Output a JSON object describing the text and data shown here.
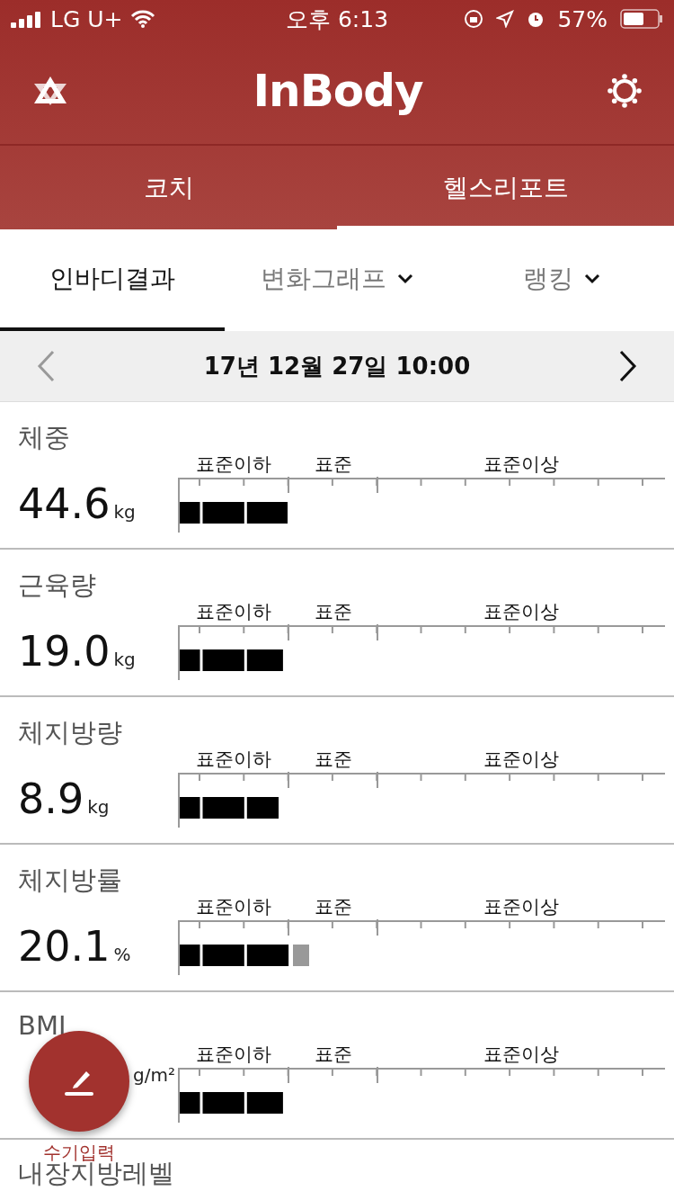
{
  "status_bar": {
    "carrier": "LG U+",
    "time": "오후 6:13",
    "battery": "57%"
  },
  "header": {
    "title": "InBody"
  },
  "main_tabs": [
    {
      "label": "코치",
      "selected": false
    },
    {
      "label": "헬스리포트",
      "selected": true
    }
  ],
  "sub_tabs": [
    {
      "label": "인바디결과",
      "selected": true,
      "dropdown": false
    },
    {
      "label": "변화그래프",
      "selected": false,
      "dropdown": true
    },
    {
      "label": "랭킹",
      "selected": false,
      "dropdown": true
    }
  ],
  "date_nav": {
    "date": "17년 12월 27일 10:00"
  },
  "rows": [
    {
      "name": "체중",
      "value": "44.6",
      "unit": "kg",
      "level": 0.222,
      "scale_labels": [
        "표준이하",
        "표준",
        "표준이상"
      ]
    },
    {
      "name": "근육량",
      "value": "19.0",
      "unit": "kg",
      "level": 0.212,
      "scale_labels": [
        "표준이하",
        "표준",
        "표준이상"
      ]
    },
    {
      "name": "체지방량",
      "value": "8.9",
      "unit": "kg",
      "level": 0.203,
      "scale_labels": [
        "표준이하",
        "표준",
        "표준이상"
      ]
    },
    {
      "name": "체지방률",
      "value": "20.1",
      "unit": "%",
      "level": 0.227,
      "over": {
        "level": 0.266
      },
      "scale_labels": [
        "표준이하",
        "표준",
        "표준이상"
      ]
    },
    {
      "name": "BMI",
      "unit": "g/m²",
      "level": 0.212,
      "scale_labels": [
        "표준이하",
        "표준",
        "표준이상"
      ]
    }
  ],
  "partial_row": {
    "name": "내장지방레벨"
  },
  "fab": {
    "label": "수기입력"
  }
}
